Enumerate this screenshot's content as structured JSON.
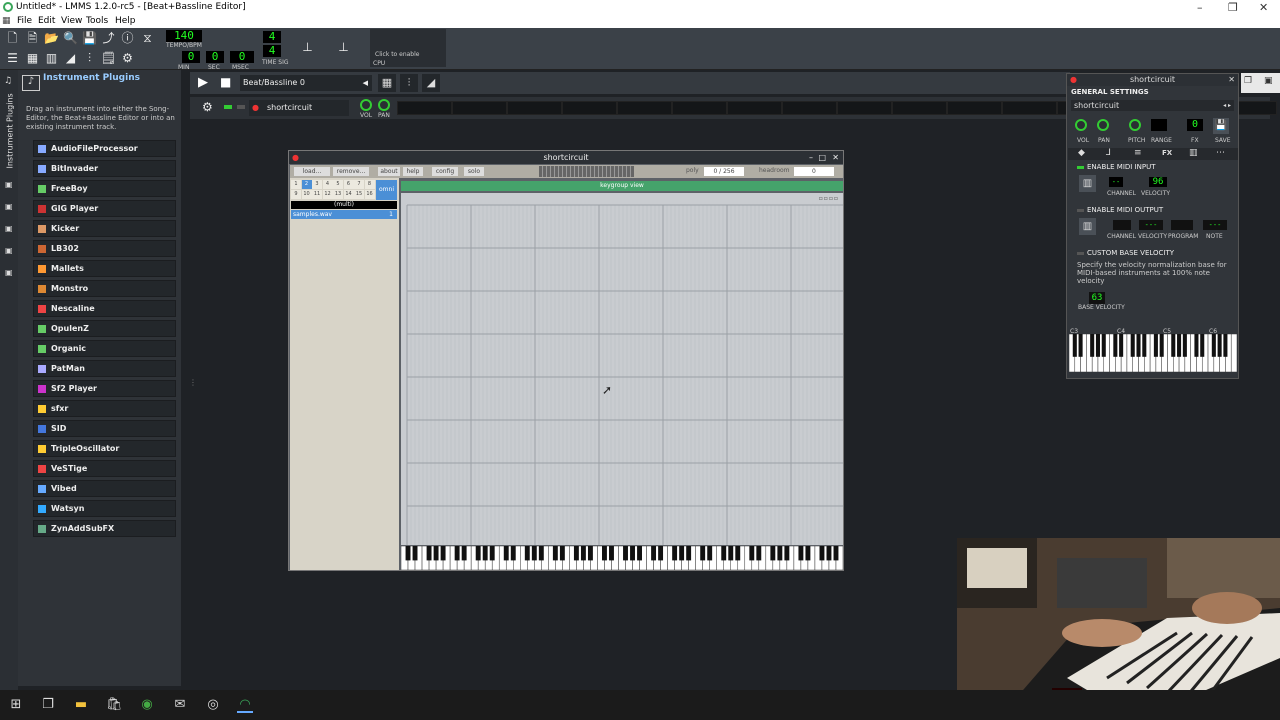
{
  "window": {
    "title": "Untitled* - LMMS 1.2.0-rc5 - [Beat+Bassline Editor]"
  },
  "menu": [
    "File",
    "Edit",
    "View",
    "Tools",
    "Help"
  ],
  "toolbar": {
    "tempo": "140",
    "tempo_label": "TEMPO/BPM",
    "min": "0",
    "min_label": "MIN",
    "sec": "0",
    "sec_label": "SEC",
    "msec": "0",
    "msec_label": "MSEC",
    "timesig_num": "4",
    "timesig_den": "4",
    "timesig_label": "TIME SIG",
    "cpu_hint": "Click to enable",
    "cpu_label": "CPU"
  },
  "plugins": {
    "title": "Instrument Plugins",
    "side_tab": "Instrument Plugins",
    "description": "Drag an instrument into either the Song-Editor, the Beat+Bassline Editor or into an existing instrument track.",
    "items": [
      "AudioFileProcessor",
      "BitInvader",
      "FreeBoy",
      "GIG Player",
      "Kicker",
      "LB302",
      "Mallets",
      "Monstro",
      "Nescaline",
      "OpulenZ",
      "Organic",
      "PatMan",
      "Sf2 Player",
      "sfxr",
      "SID",
      "TripleOscillator",
      "VeSTige",
      "Vibed",
      "Watsyn",
      "ZynAddSubFX"
    ]
  },
  "bb": {
    "pattern": "Beat/Bassline 0",
    "track": "shortcircuit",
    "vol": "VOL",
    "pan": "PAN"
  },
  "sc": {
    "title": "shortcircuit",
    "load": "load...",
    "remove": "remove...",
    "about": "about",
    "help": "help",
    "config": "config",
    "solo": "solo",
    "poly_label": "poly",
    "poly": "0 / 256",
    "headroom_label": "headroom",
    "headroom": "0",
    "omni": "omni",
    "multi": "(multi)",
    "sample": "samples.wav",
    "sample_num": "1",
    "keygroup": "keygroup view",
    "channels": [
      "1",
      "2",
      "3",
      "4",
      "5",
      "6",
      "7",
      "8",
      "9",
      "10",
      "11",
      "12",
      "13",
      "14",
      "15",
      "16"
    ]
  },
  "inst": {
    "title": "shortcircuit",
    "general": "GENERAL SETTINGS",
    "name": "shortcircuit",
    "vol": "VOL",
    "pan": "PAN",
    "pitch": "PITCH",
    "range": "RANGE",
    "fx": "FX",
    "save": "SAVE",
    "fx_tab": "FX",
    "midi_in": "ENABLE MIDI INPUT",
    "channel": "CHANNEL",
    "velocity": "VELOCITY",
    "vel_val": "96",
    "midi_out": "ENABLE MIDI OUTPUT",
    "program": "PROGRAM",
    "note": "NOTE",
    "base_vel_title": "CUSTOM BASE VELOCITY",
    "base_vel_desc": "Specify the velocity normalization base for MIDI-based instruments at 100% note velocity",
    "base_vel": "63",
    "base_vel_label": "BASE VELOCITY",
    "c3": "C3",
    "c4": "C4",
    "c5": "C5",
    "c6": "C6"
  },
  "colors": {
    "accent": "#33cc33",
    "lcd": "#22ff22",
    "panel": "#2f3338"
  }
}
